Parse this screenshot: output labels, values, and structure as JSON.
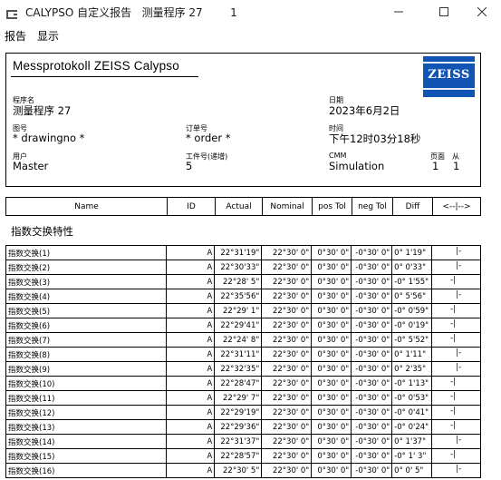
{
  "window": {
    "title": "CALYPSO 自定义报告   测量程序 27        1"
  },
  "menu": {
    "items": [
      "报告",
      "显示"
    ]
  },
  "header": {
    "title": "Messprotokoll  ZEISS  Calypso",
    "logo_text": "ZEISS",
    "fields": {
      "program_label": "程序名",
      "program_value": "测量程序 27",
      "date_label": "日期",
      "date_value": "2023年6月2日",
      "drawing_label": "图号",
      "drawing_value": "* drawingno *",
      "order_label": "订单号",
      "order_value": "* order *",
      "time_label": "时间",
      "time_value": "下午12时03分18秒",
      "user_label": "用户",
      "user_value": "Master",
      "part_label": "工件号(递增)",
      "part_value": "5",
      "cmm_label": "CMM",
      "cmm_value": "Simulation",
      "page_label": "页面",
      "page_value": "1",
      "of_label": "从",
      "of_value": "1"
    }
  },
  "columns": [
    "Name",
    "ID",
    "Actual",
    "Nominal",
    "pos Tol",
    "neg Tol",
    "Diff",
    "<--|-->"
  ],
  "section_title": "指数交换特性",
  "rows": [
    {
      "name": "指数交换(1)",
      "id": "A",
      "actual": "22°31'19\"",
      "nominal": "22°30' 0\"",
      "pos": "0°30' 0\"",
      "neg": "-0°30' 0\"",
      "diff": "0° 1'19\"",
      "bar": "|-",
      "side": "right"
    },
    {
      "name": "指数交换(2)",
      "id": "A",
      "actual": "22°30'33\"",
      "nominal": "22°30' 0\"",
      "pos": "0°30' 0\"",
      "neg": "-0°30' 0\"",
      "diff": "0° 0'33\"",
      "bar": "|-",
      "side": "right"
    },
    {
      "name": "指数交换(3)",
      "id": "A",
      "actual": "22°28' 5\"",
      "nominal": "22°30' 0\"",
      "pos": "0°30' 0\"",
      "neg": "-0°30' 0\"",
      "diff": "-0° 1'55\"",
      "bar": "-|",
      "side": "left"
    },
    {
      "name": "指数交换(4)",
      "id": "A",
      "actual": "22°35'56\"",
      "nominal": "22°30' 0\"",
      "pos": "0°30' 0\"",
      "neg": "-0°30' 0\"",
      "diff": "0° 5'56\"",
      "bar": "|-",
      "side": "right"
    },
    {
      "name": "指数交换(5)",
      "id": "A",
      "actual": "22°29' 1\"",
      "nominal": "22°30' 0\"",
      "pos": "0°30' 0\"",
      "neg": "-0°30' 0\"",
      "diff": "-0° 0'59\"",
      "bar": "-|",
      "side": "left"
    },
    {
      "name": "指数交换(6)",
      "id": "A",
      "actual": "22°29'41\"",
      "nominal": "22°30' 0\"",
      "pos": "0°30' 0\"",
      "neg": "-0°30' 0\"",
      "diff": "-0° 0'19\"",
      "bar": "-|",
      "side": "left"
    },
    {
      "name": "指数交换(7)",
      "id": "A",
      "actual": "22°24' 8\"",
      "nominal": "22°30' 0\"",
      "pos": "0°30' 0\"",
      "neg": "-0°30' 0\"",
      "diff": "-0° 5'52\"",
      "bar": "-|",
      "side": "left"
    },
    {
      "name": "指数交换(8)",
      "id": "A",
      "actual": "22°31'11\"",
      "nominal": "22°30' 0\"",
      "pos": "0°30' 0\"",
      "neg": "-0°30' 0\"",
      "diff": "0° 1'11\"",
      "bar": "|-",
      "side": "right"
    },
    {
      "name": "指数交换(9)",
      "id": "A",
      "actual": "22°32'35\"",
      "nominal": "22°30' 0\"",
      "pos": "0°30' 0\"",
      "neg": "-0°30' 0\"",
      "diff": "0° 2'35\"",
      "bar": "|-",
      "side": "right"
    },
    {
      "name": "指数交换(10)",
      "id": "A",
      "actual": "22°28'47\"",
      "nominal": "22°30' 0\"",
      "pos": "0°30' 0\"",
      "neg": "-0°30' 0\"",
      "diff": "-0° 1'13\"",
      "bar": "-|",
      "side": "left"
    },
    {
      "name": "指数交换(11)",
      "id": "A",
      "actual": "22°29' 7\"",
      "nominal": "22°30' 0\"",
      "pos": "0°30' 0\"",
      "neg": "-0°30' 0\"",
      "diff": "-0° 0'53\"",
      "bar": "-|",
      "side": "left"
    },
    {
      "name": "指数交换(12)",
      "id": "A",
      "actual": "22°29'19\"",
      "nominal": "22°30' 0\"",
      "pos": "0°30' 0\"",
      "neg": "-0°30' 0\"",
      "diff": "-0° 0'41\"",
      "bar": "-|",
      "side": "left"
    },
    {
      "name": "指数交换(13)",
      "id": "A",
      "actual": "22°29'36\"",
      "nominal": "22°30' 0\"",
      "pos": "0°30' 0\"",
      "neg": "-0°30' 0\"",
      "diff": "-0° 0'24\"",
      "bar": "-|",
      "side": "left"
    },
    {
      "name": "指数交换(14)",
      "id": "A",
      "actual": "22°31'37\"",
      "nominal": "22°30' 0\"",
      "pos": "0°30' 0\"",
      "neg": "-0°30' 0\"",
      "diff": "0° 1'37\"",
      "bar": "|-",
      "side": "right"
    },
    {
      "name": "指数交换(15)",
      "id": "A",
      "actual": "22°28'57\"",
      "nominal": "22°30' 0\"",
      "pos": "0°30' 0\"",
      "neg": "-0°30' 0\"",
      "diff": "-0° 1' 3\"",
      "bar": "-|",
      "side": "left"
    },
    {
      "name": "指数交换(16)",
      "id": "A",
      "actual": "22°30' 5\"",
      "nominal": "22°30' 0\"",
      "pos": "0°30' 0\"",
      "neg": "-0°30' 0\"",
      "diff": "0° 0' 5\"",
      "bar": "|-",
      "side": "right"
    }
  ]
}
